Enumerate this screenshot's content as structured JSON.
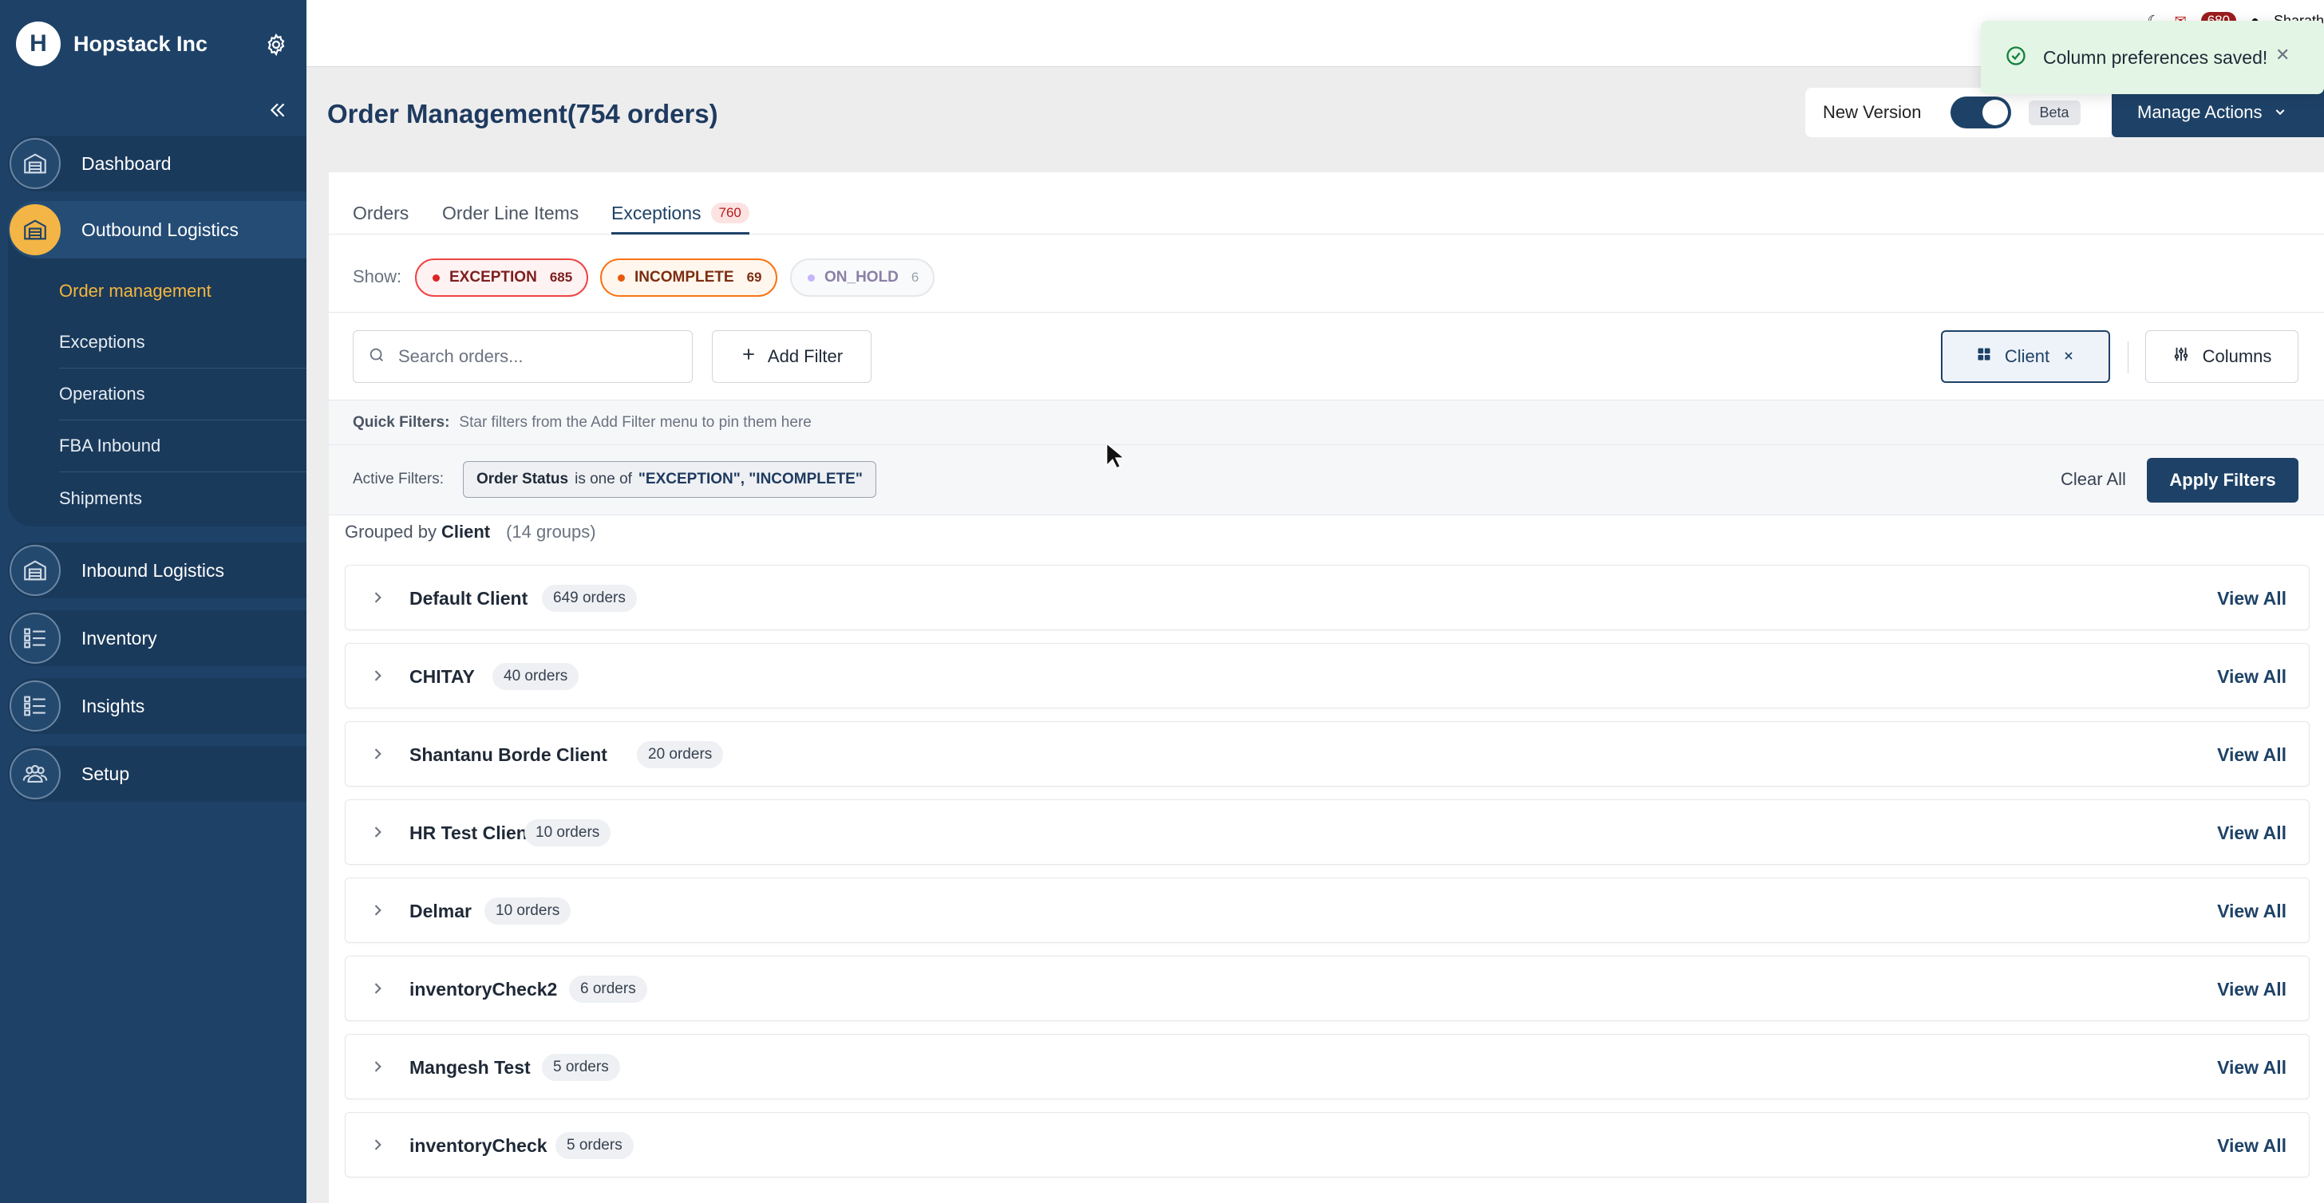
{
  "sidebar": {
    "brand": "Hopstack Inc",
    "brand_initial": "H",
    "items": [
      {
        "label": "Dashboard",
        "icon": "warehouse-icon"
      },
      {
        "label": "Outbound Logistics",
        "icon": "warehouse-icon",
        "active": true
      },
      {
        "label": "Inbound Logistics",
        "icon": "warehouse-icon"
      },
      {
        "label": "Inventory",
        "icon": "list-check-icon"
      },
      {
        "label": "Insights",
        "icon": "list-check-icon"
      },
      {
        "label": "Setup",
        "icon": "people-icon"
      }
    ],
    "sub_items": [
      "Order management",
      "Exceptions",
      "Operations",
      "FBA Inbound",
      "Shipments"
    ]
  },
  "topbar": {
    "notification_count": "680",
    "user_name": "Sharath"
  },
  "toast": {
    "message": "Column preferences saved!"
  },
  "header": {
    "title": "Order Management(754 orders)",
    "new_version_label": "New Version",
    "new_version_on": true,
    "beta_label": "Beta",
    "manage_actions_label": "Manage Actions"
  },
  "tabs": [
    {
      "label": "Orders"
    },
    {
      "label": "Order Line Items"
    },
    {
      "label": "Exceptions",
      "count": "760",
      "active": true
    }
  ],
  "show": {
    "label": "Show:",
    "chips": [
      {
        "label": "EXCEPTION",
        "count": "685"
      },
      {
        "label": "INCOMPLETE",
        "count": "69"
      },
      {
        "label": "ON_HOLD",
        "count": "6"
      }
    ]
  },
  "filters": {
    "search_placeholder": "Search orders...",
    "add_filter_label": "Add Filter",
    "client_label": "Client",
    "columns_label": "Columns",
    "quick_label": "Quick Filters:",
    "quick_text": "Star filters from the Add Filter menu to pin them here",
    "active_label": "Active Filters:",
    "active_field": "Order Status",
    "active_op": "is one of",
    "active_values": "\"EXCEPTION\", \"INCOMPLETE\"",
    "clear_all_label": "Clear All",
    "apply_label": "Apply Filters"
  },
  "grouping": {
    "prefix": "Grouped by",
    "field": "Client",
    "count": "(14 groups)",
    "view_all_label": "View All",
    "groups": [
      {
        "name": "Default Client",
        "orders": "649 orders"
      },
      {
        "name": "CHITAY",
        "orders": "40 orders"
      },
      {
        "name": "Shantanu Borde Client",
        "orders": "20 orders"
      },
      {
        "name": "HR Test Client",
        "orders": "10 orders"
      },
      {
        "name": "Delmar",
        "orders": "10 orders"
      },
      {
        "name": "inventoryCheck2",
        "orders": "6 orders"
      },
      {
        "name": "Mangesh Test",
        "orders": "5 orders"
      },
      {
        "name": "inventoryCheck",
        "orders": "5 orders"
      }
    ]
  },
  "colors": {
    "primary": "#1e4267",
    "accent": "#f3b545",
    "exception": "#dc2626",
    "incomplete": "#ea580c"
  }
}
